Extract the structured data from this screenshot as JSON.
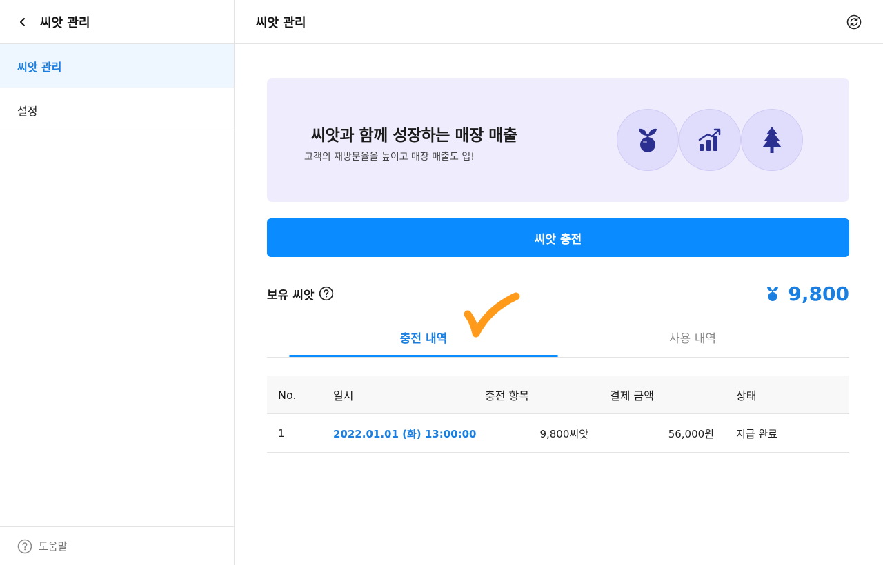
{
  "sidebar": {
    "title": "씨앗 관리",
    "items": [
      {
        "label": "씨앗 관리",
        "active": true
      },
      {
        "label": "설정",
        "active": false
      }
    ],
    "help_label": "도움말"
  },
  "header": {
    "title": "씨앗 관리"
  },
  "banner": {
    "title": "씨앗과 함께 성장하는 매장 매출",
    "subtitle": "고객의 재방문율을 높이고 매장 매출도 업!",
    "icons": [
      "seed-icon",
      "growth-chart-icon",
      "tree-icon"
    ]
  },
  "charge_button": {
    "label": "씨앗 충전"
  },
  "balance": {
    "label": "보유 씨앗",
    "amount": "9,800"
  },
  "tabs": [
    {
      "label": "충전 내역",
      "active": true
    },
    {
      "label": "사용 내역",
      "active": false
    }
  ],
  "table": {
    "headers": {
      "no": "No.",
      "date": "일시",
      "item": "충전 항목",
      "amount": "결제 금액",
      "status": "상태"
    },
    "rows": [
      {
        "no": "1",
        "date": "2022.01.01 (화) 13:00:00",
        "item": "9,800씨앗",
        "amount": "56,000원",
        "status": "지급 완료"
      }
    ]
  },
  "colors": {
    "accent": "#0a8bff",
    "accent_text": "#1a7fe0",
    "banner_bg": "#efedfd",
    "icon_indigo": "#2b2f8f",
    "checkmark": "#ff9a1a"
  }
}
